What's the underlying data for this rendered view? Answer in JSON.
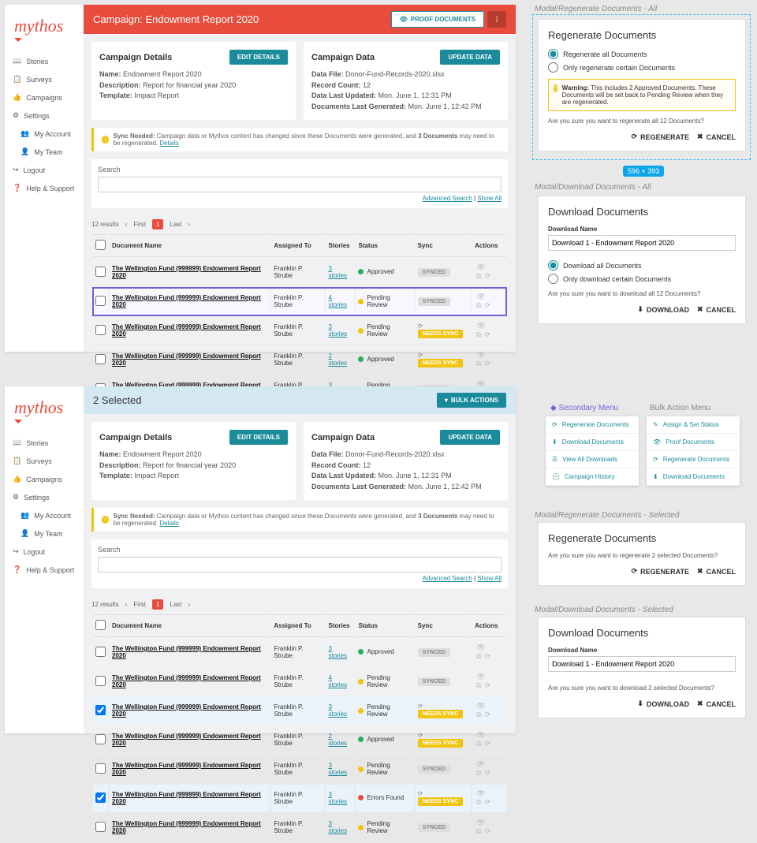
{
  "sidebar": {
    "logo": "mythos",
    "items": [
      "Stories",
      "Surveys",
      "Campaigns",
      "Settings",
      "My Account",
      "My Team",
      "Logout",
      "Help & Support"
    ]
  },
  "header1": {
    "title": "Campaign: Endowment Report 2020",
    "proof": "PROOF DOCUMENTS"
  },
  "header2": {
    "title": "2 Selected",
    "bulk": "BULK ACTIONS"
  },
  "details": {
    "title": "Campaign Details",
    "edit": "EDIT DETAILS",
    "name_lbl": "Name:",
    "name": "Endowment Report 2020",
    "desc_lbl": "Description:",
    "desc": "Report for financial year 2020",
    "tmpl_lbl": "Template:",
    "tmpl": "Impact Report"
  },
  "data": {
    "title": "Campaign Data",
    "update": "UPDATE DATA",
    "file_lbl": "Data File:",
    "file": "Donor-Fund-Records-2020.xlsx",
    "count_lbl": "Record Count:",
    "count": "12",
    "upd_lbl": "Data Last Updated:",
    "upd": "Mon. June 1, 12:31 PM",
    "gen_lbl": "Documents Last Generated:",
    "gen": "Mon. June 1, 12:42 PM"
  },
  "alert": {
    "lead": "Sync Needed:",
    "body": "Campaign data or Mythos content has changed since these Documents were generated, and ",
    "bold": "3 Documents",
    "tail": " may need to be regenerated. ",
    "link": "Details"
  },
  "search": {
    "label": "Search",
    "adv": "Advanced Search",
    "all": "Show All"
  },
  "pager": {
    "results": "12 results",
    "first": "First",
    "page": "1",
    "last": "Last"
  },
  "cols": {
    "doc": "Document Name",
    "assigned": "Assigned To",
    "stories": "Stories",
    "status": "Status",
    "sync": "Sync",
    "actions": "Actions"
  },
  "rows": [
    {
      "doc": "The Wellington Fund (999999) Endowment Report 2020",
      "assigned": "Franklin P. Strube",
      "stories": "3 stories",
      "status": "Approved",
      "sd": "g",
      "sync": "SYNCED",
      "need": false
    },
    {
      "doc": "The Wellington Fund (999999) Endowment Report 2020",
      "assigned": "Franklin P. Strube",
      "stories": "4 stories",
      "status": "Pending Review",
      "sd": "y",
      "sync": "SYNCED",
      "need": false
    },
    {
      "doc": "The Wellington Fund (999999) Endowment Report 2020",
      "assigned": "Franklin P. Strube",
      "stories": "3 stories",
      "status": "Pending Review",
      "sd": "y",
      "sync": "NEEDS SYNC",
      "need": true
    },
    {
      "doc": "The Wellington Fund (999999) Endowment Report 2020",
      "assigned": "Franklin P. Strube",
      "stories": "2 stories",
      "status": "Approved",
      "sd": "g",
      "sync": "NEEDS SYNC",
      "need": true
    },
    {
      "doc": "The Wellington Fund (999999) Endowment Report 2020",
      "assigned": "Franklin P. Strube",
      "stories": "3 stories",
      "status": "Pending Review",
      "sd": "y",
      "sync": "SYNCED",
      "need": false
    },
    {
      "doc": "The Wellington Fund (999999) Endowment Report 2020",
      "assigned": "Franklin P. Strube",
      "stories": "3 stories",
      "status": "Errors Found",
      "sd": "r",
      "sync": "NEEDS SYNC",
      "need": true
    },
    {
      "doc": "The Wellington Fund (999999) Endowment Report 2020",
      "assigned": "Franklin P. Strube",
      "stories": "3 stories",
      "status": "Pending Review",
      "sd": "y",
      "sync": "SYNCED",
      "need": false
    }
  ],
  "modal_regen": {
    "label": "Modal/Regenerate Documents - All",
    "title": "Regenerate Documents",
    "opt1": "Regenerate all Documents",
    "opt2": "Only regenerate certain Documents",
    "warn_lead": "Warning:",
    "warn": " This includes 2 Approved Documents. These Documents will be set back to Pending Review when they are regenerated.",
    "q": "Are you sure you want to regenerate all 12 Documents?",
    "go": "REGENERATE",
    "cancel": "CANCEL",
    "size": "596 × 393"
  },
  "modal_dl": {
    "label": "Modal/Download Documents - All",
    "title": "Download Documents",
    "name_lbl": "Download Name",
    "name": "Download 1 - Endowment Report 2020",
    "opt1": "Download all Documents",
    "opt2": "Only download certain Documents",
    "q": "Are you sure you want to download all 12 Documents?",
    "go": "DOWNLOAD",
    "cancel": "CANCEL"
  },
  "menus": {
    "sec_title": "Secondary Menu",
    "bulk_title": "Bulk Action Menu",
    "sec": [
      "Regenerate Documents",
      "Download Documents",
      "View All Downloads",
      "Campaign History"
    ],
    "bulk": [
      "Assign & Set Status",
      "Proof Documents",
      "Regenerate Documents",
      "Download Documents"
    ]
  },
  "modal_regen_sel": {
    "label": "Modal/Regenerate Documents - Selected",
    "title": "Regenerate Documents",
    "q": "Are you sure you want to regenerate 2 selected Documents?",
    "go": "REGENERATE",
    "cancel": "CANCEL"
  },
  "modal_dl_sel": {
    "label": "Modal/Download Documents - Selected",
    "title": "Download Documents",
    "name_lbl": "Download Name",
    "name": "Download 1 - Endowment Report 2020",
    "q": "Are you sure you want to download 2 selected Documents?",
    "go": "DOWNLOAD",
    "cancel": "CANCEL"
  }
}
